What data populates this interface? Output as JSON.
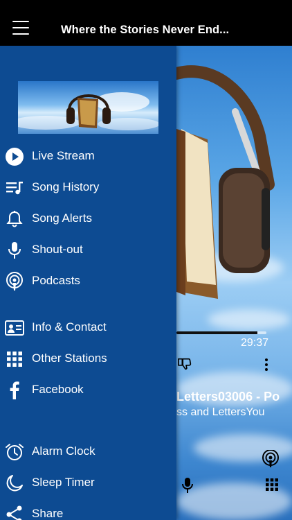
{
  "header": {
    "title": "Where the Stories Never End..."
  },
  "player": {
    "progress": 0.9,
    "elapsed_time": "29:37",
    "track_title": "Letters03006 - Po",
    "track_artist": "ss and LettersYou"
  },
  "drawer": {
    "background_color": "#0d4b92",
    "logo": {
      "icon": "headphones-book-logo"
    },
    "items": [
      {
        "label": "Live Stream",
        "icon": "play-circle-icon"
      },
      {
        "label": "Song History",
        "icon": "song-history-icon"
      },
      {
        "label": "Song Alerts",
        "icon": "bell-icon"
      },
      {
        "label": "Shout-out",
        "icon": "microphone-icon"
      },
      {
        "label": "Podcasts",
        "icon": "podcast-icon"
      },
      {
        "label": "Info & Contact",
        "icon": "contact-card-icon"
      },
      {
        "label": "Other Stations",
        "icon": "grid-icon"
      },
      {
        "label": "Facebook",
        "icon": "facebook-icon"
      },
      {
        "label": "Alarm Clock",
        "icon": "alarm-clock-icon"
      },
      {
        "label": "Sleep Timer",
        "icon": "moon-icon"
      },
      {
        "label": "Share",
        "icon": "share-icon"
      }
    ]
  }
}
